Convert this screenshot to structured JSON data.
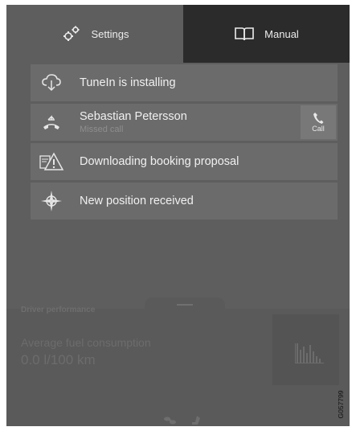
{
  "tabs": {
    "settings_label": "Settings",
    "manual_label": "Manual"
  },
  "notifications": [
    {
      "title": "TuneIn is installing",
      "icon": "cloud-download-icon"
    },
    {
      "title": "Sebastian Petersson",
      "subtitle": "Missed call",
      "icon": "missed-call-icon",
      "action_label": "Call"
    },
    {
      "title": "Downloading booking proposal",
      "icon": "service-warning-icon"
    },
    {
      "title": "New position received",
      "icon": "position-compass-icon"
    }
  ],
  "background": {
    "driver_performance_label": "Driver performance",
    "fuel_label": "Average fuel consumption",
    "fuel_value": "0.0 l/100 km"
  },
  "figure_id": "G057799",
  "colors": {
    "panel": "#5e5e5e",
    "active_tab": "#2b2b2b",
    "notification": "#6b6b6b"
  }
}
